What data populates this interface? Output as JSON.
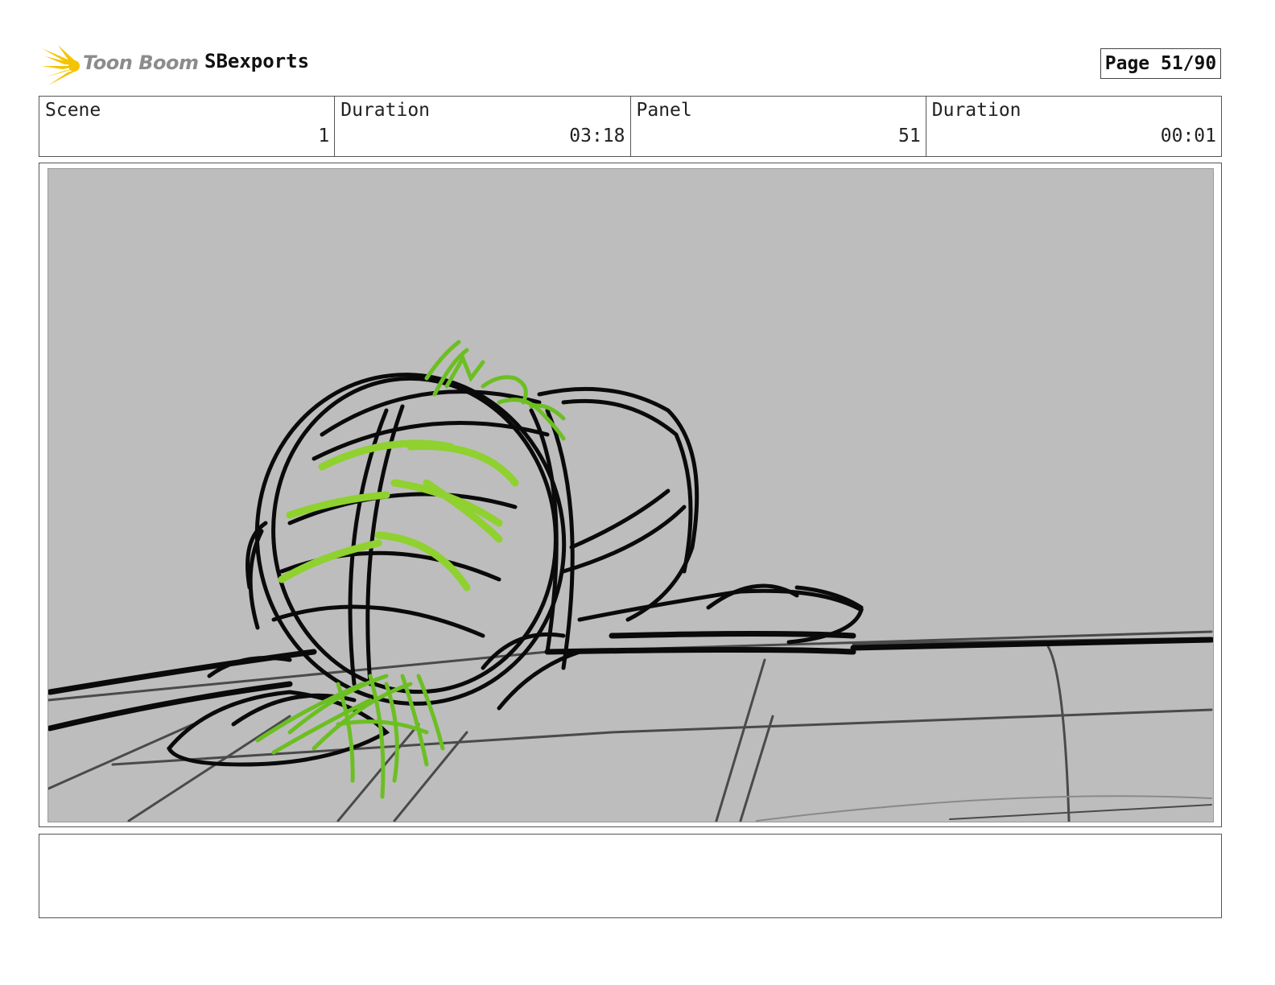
{
  "header": {
    "logo_text": "Toon Boom",
    "project_name": "SBexports",
    "page_label": "Page 51/90"
  },
  "info": {
    "scene_label": "Scene",
    "scene_value": "1",
    "scene_duration_label": "Duration",
    "scene_duration_value": "03:18",
    "panel_label": "Panel",
    "panel_value": "51",
    "panel_duration_label": "Duration",
    "panel_duration_value": "00:01"
  },
  "colors": {
    "logo_yellow": "#f5c400",
    "sketch_black": "#0a0a0a",
    "sketch_green": "#8fd12e",
    "panel_bg": "#bdbdbd"
  },
  "notes": {
    "text": ""
  }
}
